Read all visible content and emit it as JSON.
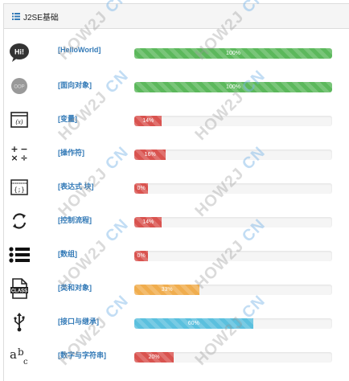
{
  "panel": {
    "title": "J2SE基础"
  },
  "items": [
    {
      "label": "[HelloWorld]",
      "percent_text": "100%",
      "percent": 100,
      "style": "success",
      "icon": "hi-speech-bubble-icon"
    },
    {
      "label": "[面向对象]",
      "percent_text": "100%",
      "percent": 100,
      "style": "success",
      "icon": "oop-circle-icon"
    },
    {
      "label": "[变量]",
      "percent_text": "14%",
      "percent": 14,
      "style": "danger",
      "icon": "variable-window-icon"
    },
    {
      "label": "[操作符]",
      "percent_text": "16%",
      "percent": 16,
      "style": "danger",
      "icon": "math-operators-icon"
    },
    {
      "label": "[表达式 块]",
      "percent_text": "0%",
      "percent": 0,
      "style": "danger",
      "icon": "code-block-window-icon"
    },
    {
      "label": "[控制流程]",
      "percent_text": "14%",
      "percent": 14,
      "style": "danger",
      "icon": "refresh-cycle-icon"
    },
    {
      "label": "[数组]",
      "percent_text": "0%",
      "percent": 0,
      "style": "danger",
      "icon": "bullet-list-icon"
    },
    {
      "label": "[类和对象]",
      "percent_text": "33%",
      "percent": 33,
      "style": "warning",
      "icon": "class-file-icon"
    },
    {
      "label": "[接口与继承]",
      "percent_text": "60%",
      "percent": 60,
      "style": "info",
      "icon": "usb-icon"
    },
    {
      "label": "[数字与字符串]",
      "percent_text": "20%",
      "percent": 20,
      "style": "danger",
      "icon": "abc-text-icon"
    }
  ],
  "watermark": {
    "text": "HOW2J",
    "cn": "CN"
  },
  "colors": {
    "success": "#5cb85c",
    "danger": "#d9534f",
    "warning": "#f0ad4e",
    "info": "#5bc0de",
    "link": "#337ab7"
  }
}
